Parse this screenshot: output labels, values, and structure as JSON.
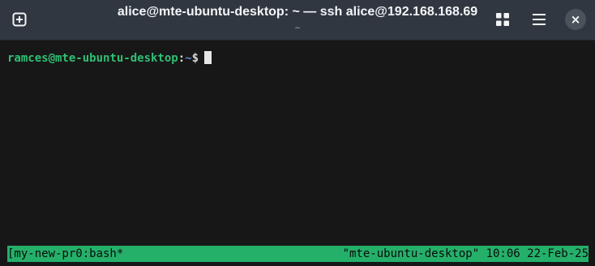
{
  "window": {
    "title": "alice@mte-ubuntu-desktop: ~ — ssh alice@192.168.168.69",
    "subtitle": "~"
  },
  "titlebar": {
    "icons": [
      "new-tab-icon",
      "grid-icon",
      "hamburger-menu-icon",
      "close-icon"
    ],
    "close_glyph": "×"
  },
  "terminal": {
    "prompt": {
      "user_host": "ramces@mte-ubuntu-desktop",
      "colon": ":",
      "path": "~",
      "symbol": "$"
    },
    "statusbar": {
      "left": "[my-new-pr0:bash*",
      "right": "\"mte-ubuntu-desktop\" 10:06 22-Feb-25"
    }
  },
  "colors": {
    "titlebar_bg": "#303740",
    "terminal_bg": "#171717",
    "prompt_user": "#2fbf73",
    "prompt_path": "#5f88c9",
    "statusbar_bg": "#25b06a"
  }
}
